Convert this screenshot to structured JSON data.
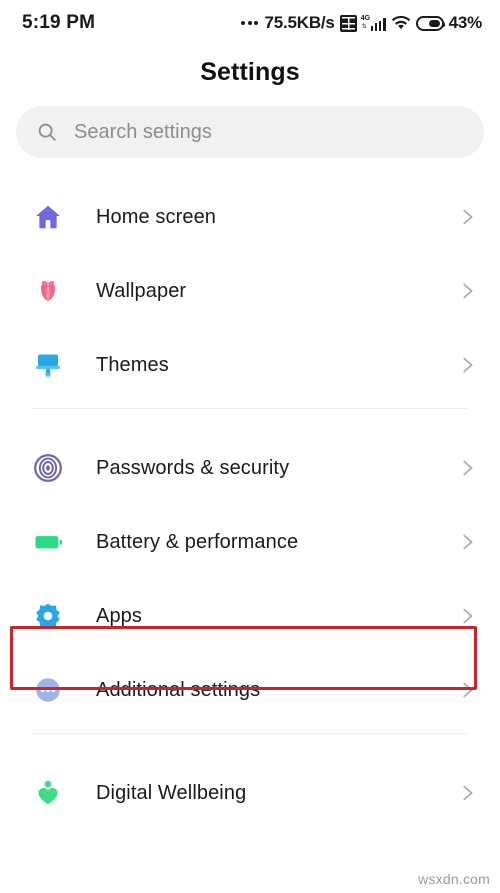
{
  "statusbar": {
    "time": "5:19 PM",
    "net_speed": "75.5KB/s",
    "sim_icon": "sim-card-icon",
    "signal_icon": "signal-4g-icon",
    "signal_label": "4G",
    "wifi_icon": "wifi-icon",
    "battery_icon": "battery-icon",
    "battery_percent": "43%"
  },
  "header": {
    "title": "Settings"
  },
  "search": {
    "placeholder": "Search settings",
    "icon": "search-icon"
  },
  "groups": [
    {
      "items": [
        {
          "label": "Home screen",
          "icon": "home-icon"
        },
        {
          "label": "Wallpaper",
          "icon": "flower-icon"
        },
        {
          "label": "Themes",
          "icon": "paintbrush-icon"
        }
      ]
    },
    {
      "items": [
        {
          "label": "Passwords & security",
          "icon": "fingerprint-icon"
        },
        {
          "label": "Battery & performance",
          "icon": "battery-green-icon"
        },
        {
          "label": "Apps",
          "icon": "gear-icon",
          "highlighted": true
        },
        {
          "label": "Additional settings",
          "icon": "more-dots-icon"
        }
      ]
    },
    {
      "items": [
        {
          "label": "Digital Wellbeing",
          "icon": "heart-person-icon"
        }
      ]
    }
  ],
  "chevron_icon": "chevron-right-icon",
  "highlight": {
    "color": "#c1272d",
    "target": "Apps"
  },
  "watermark": {
    "text": "wsxdn.com"
  },
  "colors": {
    "home": "#6f69dd",
    "wallpaper": "#f4638a",
    "themes": "#29a8e8",
    "security": "#6f69a8",
    "battery": "#2fd98a",
    "apps": "#2aa6e8",
    "additional": "#9fb3e8",
    "wellbeing": "#3ddc84",
    "highlight": "#c1272d"
  }
}
